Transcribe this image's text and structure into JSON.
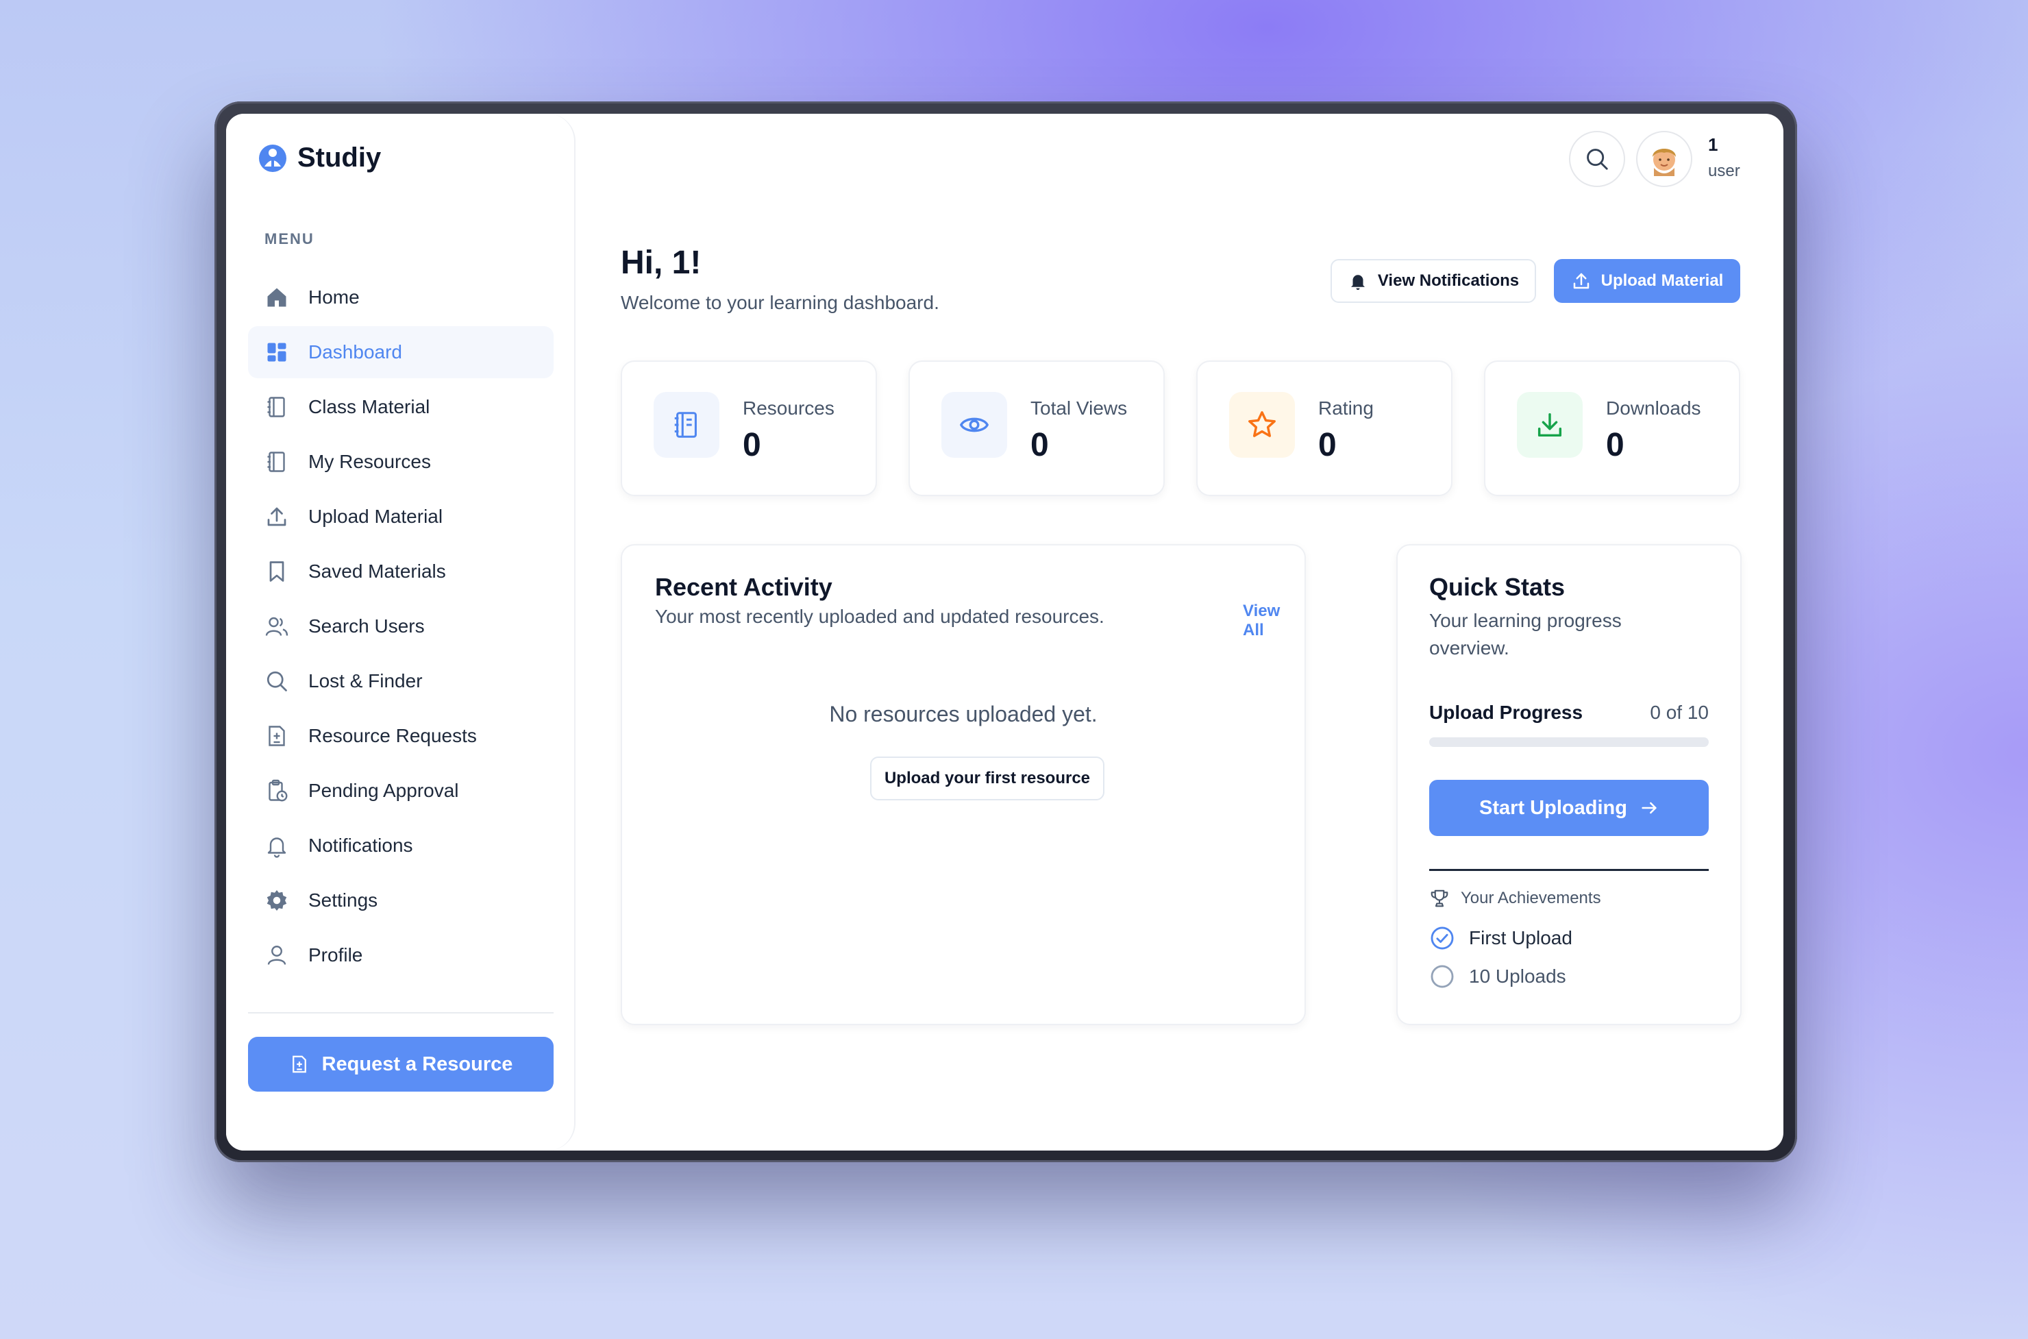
{
  "app": {
    "name": "Studiy"
  },
  "sidebar": {
    "menu_label": "MENU",
    "items": [
      {
        "label": "Home",
        "icon": "home-icon"
      },
      {
        "label": "Dashboard",
        "icon": "dashboard-icon",
        "active": true
      },
      {
        "label": "Class Material",
        "icon": "notebook-icon"
      },
      {
        "label": "My Resources",
        "icon": "notebook-icon"
      },
      {
        "label": "Upload Material",
        "icon": "upload-icon"
      },
      {
        "label": "Saved Materials",
        "icon": "bookmark-icon"
      },
      {
        "label": "Search Users",
        "icon": "users-icon"
      },
      {
        "label": "Lost & Finder",
        "icon": "search-icon"
      },
      {
        "label": "Resource Requests",
        "icon": "file-plus-icon"
      },
      {
        "label": "Pending Approval",
        "icon": "clipboard-clock-icon"
      },
      {
        "label": "Notifications",
        "icon": "bell-icon"
      },
      {
        "label": "Settings",
        "icon": "gear-icon"
      },
      {
        "label": "Profile",
        "icon": "user-icon"
      }
    ],
    "request_button": "Request a Resource"
  },
  "topbar": {
    "user_name": "1",
    "user_role": "user"
  },
  "header": {
    "greeting": "Hi, 1!",
    "subtitle": "Welcome to your learning dashboard.",
    "notifications_button": "View Notifications",
    "upload_button": "Upload Material"
  },
  "stats": [
    {
      "label": "Resources",
      "value": "0",
      "icon": "notebook-icon",
      "color": "#4f86f0",
      "bg": "#f1f5fd"
    },
    {
      "label": "Total Views",
      "value": "0",
      "icon": "eye-icon",
      "color": "#4f86f0",
      "bg": "#f1f5fd"
    },
    {
      "label": "Rating",
      "value": "0",
      "icon": "star-icon",
      "color": "#f97316",
      "bg": "#fff7e8"
    },
    {
      "label": "Downloads",
      "value": "0",
      "icon": "download-icon",
      "color": "#16a34a",
      "bg": "#ecfbf1"
    }
  ],
  "recent_activity": {
    "title": "Recent Activity",
    "subtitle": "Your most recently uploaded and updated resources.",
    "view_all": "View All",
    "empty_text": "No resources uploaded yet.",
    "empty_button": "Upload your first resource"
  },
  "quick_stats": {
    "title": "Quick Stats",
    "subtitle": "Your learning progress overview.",
    "upload_progress_label": "Upload Progress",
    "upload_progress_value": "0 of 10",
    "upload_progress_fraction": 0,
    "start_button": "Start Uploading",
    "achievements_title": "Your Achievements",
    "achievements": [
      {
        "label": "First Upload",
        "done": true
      },
      {
        "label": "10 Uploads",
        "done": false
      }
    ]
  },
  "colors": {
    "accent": "#5b8ef5",
    "accent_text": "#4f86f0"
  }
}
